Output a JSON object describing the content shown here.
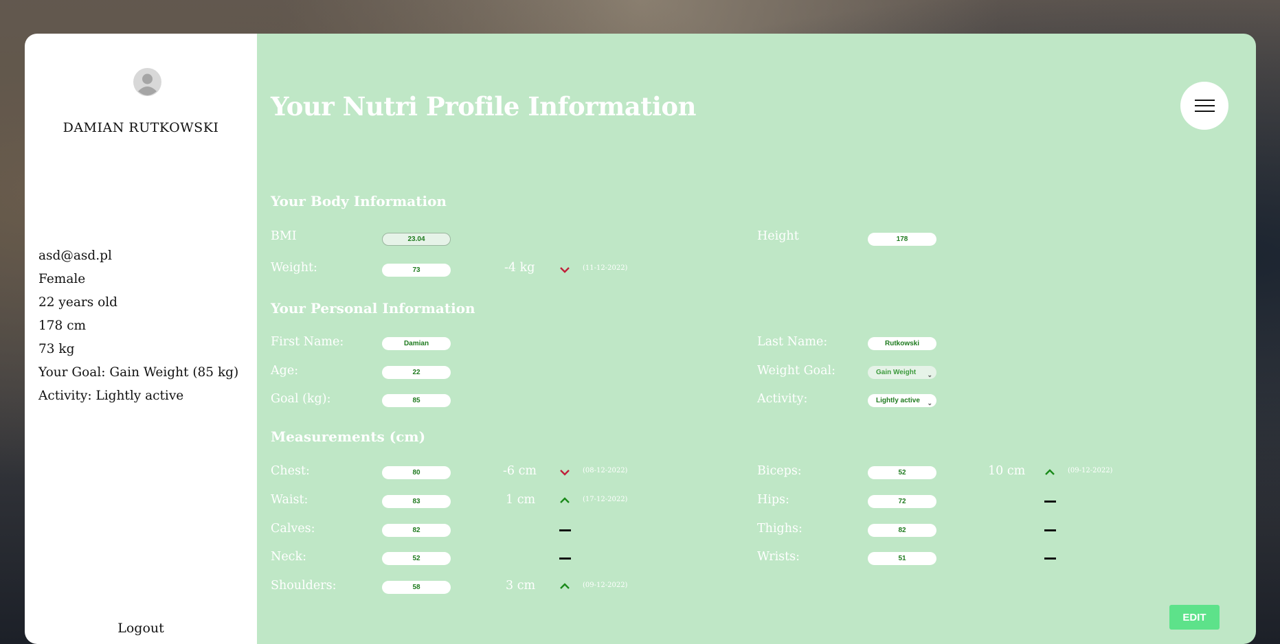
{
  "user": {
    "name": "DAMIAN RUTKOWSKI",
    "email": "asd@asd.pl",
    "gender": "Female",
    "age": "22 years old",
    "height": "178 cm",
    "weight": "73 kg",
    "goal": "Your Goal: Gain Weight (85 kg)",
    "activity": "Activity: Lightly active"
  },
  "sidebar": {
    "logout_label": "Logout",
    "avatar_icon": "user-avatar-icon"
  },
  "header": {
    "title": "Your Nutri Profile Information",
    "menu_icon": "hamburger-icon"
  },
  "body_info": {
    "title": "Your Body Information",
    "bmi_label": "BMI",
    "bmi_value": "23.04",
    "height_label": "Height",
    "height_value": "178",
    "weight_label": "Weight:",
    "weight_value": "73",
    "weight_delta": "-4 kg",
    "weight_date": "(11-12-2022)",
    "weight_trend": "down"
  },
  "personal_info": {
    "title": "Your Personal Information",
    "first_name_label": "First Name:",
    "first_name_value": "Damian",
    "last_name_label": "Last Name:",
    "last_name_value": "Rutkowski",
    "age_label": "Age:",
    "age_value": "22",
    "weight_goal_label": "Weight Goal:",
    "weight_goal_value": "Gain Weight",
    "goal_label": "Goal (kg):",
    "goal_value": "85",
    "activity_label": "Activity:",
    "activity_value": "Lightly active"
  },
  "measurements": {
    "title": "Measurements (cm)",
    "chest": {
      "label": "Chest:",
      "value": "80",
      "delta": "-6 cm",
      "date": "(08-12-2022)",
      "trend": "down"
    },
    "biceps": {
      "label": "Biceps:",
      "value": "52",
      "delta": "10 cm",
      "date": "(09-12-2022)",
      "trend": "up"
    },
    "waist": {
      "label": "Waist:",
      "value": "83",
      "delta": "1 cm",
      "date": "(17-12-2022)",
      "trend": "up"
    },
    "hips": {
      "label": "Hips:",
      "value": "72",
      "trend": "none"
    },
    "calves": {
      "label": "Calves:",
      "value": "82",
      "trend": "none"
    },
    "thighs": {
      "label": "Thighs:",
      "value": "82",
      "trend": "none"
    },
    "neck": {
      "label": "Neck:",
      "value": "52",
      "trend": "none"
    },
    "wrists": {
      "label": "Wrists:",
      "value": "51",
      "trend": "none"
    },
    "shoulders": {
      "label": "Shoulders:",
      "value": "58",
      "delta": "3 cm",
      "date": "(09-12-2022)",
      "trend": "up"
    }
  },
  "actions": {
    "edit_label": "EDIT"
  },
  "colors": {
    "panel_bg": "#bfe7c6",
    "field_text": "#1e7a1e",
    "trend_up": "#1a8a1a",
    "trend_down": "#c0203a",
    "edit_button": "#5de28a"
  }
}
